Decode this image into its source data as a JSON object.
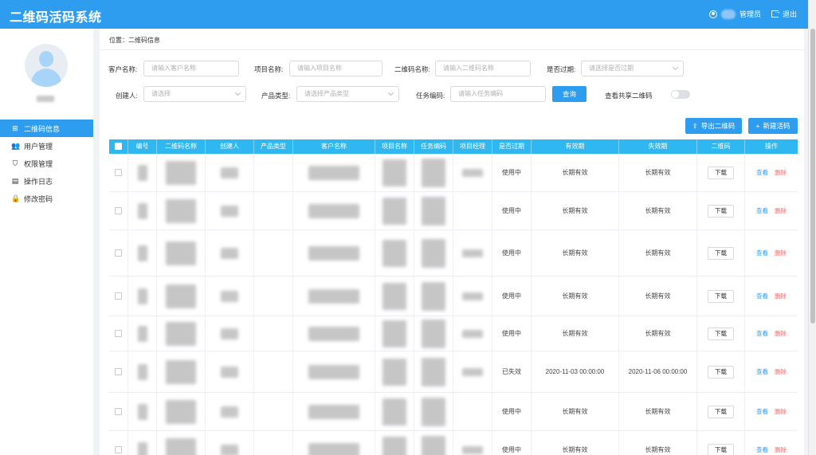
{
  "app": {
    "title": "二维码活码系统"
  },
  "header": {
    "role_label": "管理员",
    "logout_label": "退出"
  },
  "sidebar": {
    "items": [
      {
        "label": "二维码信息",
        "icon": "grid-icon"
      },
      {
        "label": "用户管理",
        "icon": "users-icon"
      },
      {
        "label": "权限管理",
        "icon": "shield-icon"
      },
      {
        "label": "操作日志",
        "icon": "log-icon"
      },
      {
        "label": "修改密码",
        "icon": "lock-icon"
      }
    ]
  },
  "breadcrumb": "位置：二维码信息",
  "filters": {
    "customer": {
      "label": "客户名称:",
      "placeholder": "请输入客户名称"
    },
    "project": {
      "label": "项目名称:",
      "placeholder": "请输入项目名称"
    },
    "qrcode": {
      "label": "二维码名称:",
      "placeholder": "请输入二维码名称"
    },
    "expired": {
      "label": "是否过期:",
      "placeholder": "请选择是否过期"
    },
    "creator": {
      "label": "创建人:",
      "placeholder": "请选择"
    },
    "product": {
      "label": "产品类型:",
      "placeholder": "请选择产品类型"
    },
    "task": {
      "label": "任务编码:",
      "placeholder": "请输入任务编码"
    },
    "query_label": "查询",
    "shared_label": "查看共享二维码"
  },
  "actions": {
    "export_label": "导出二维码",
    "new_label": "新建活码"
  },
  "table": {
    "columns": [
      "编号",
      "二维码名称",
      "创建人",
      "产品类型",
      "客户名称",
      "项目名称",
      "任务编码",
      "项目经理",
      "是否过期",
      "有效期",
      "失效期",
      "二维码",
      "操作"
    ],
    "download_label": "下载",
    "view_label": "查看",
    "delete_label": "删除",
    "rows": [
      {
        "status": "使用中",
        "valid": "长期有效",
        "invalid": "长期有效"
      },
      {
        "status": "使用中",
        "valid": "长期有效",
        "invalid": "长期有效"
      },
      {
        "status": "使用中",
        "valid": "长期有效",
        "invalid": "长期有效"
      },
      {
        "status": "使用中",
        "valid": "长期有效",
        "invalid": "长期有效"
      },
      {
        "status": "使用中",
        "valid": "长期有效",
        "invalid": "长期有效"
      },
      {
        "status": "已失效",
        "valid": "2020-11-03 00:00:00",
        "invalid": "2020-11-06 00:00:00"
      },
      {
        "status": "使用中",
        "valid": "长期有效",
        "invalid": "长期有效"
      },
      {
        "status": "使用中",
        "valid": "长期有效",
        "invalid": "长期有效"
      }
    ]
  },
  "colors": {
    "primary": "#2e9df0",
    "table_header": "#2eb7f0",
    "danger": "#f56c6c"
  }
}
